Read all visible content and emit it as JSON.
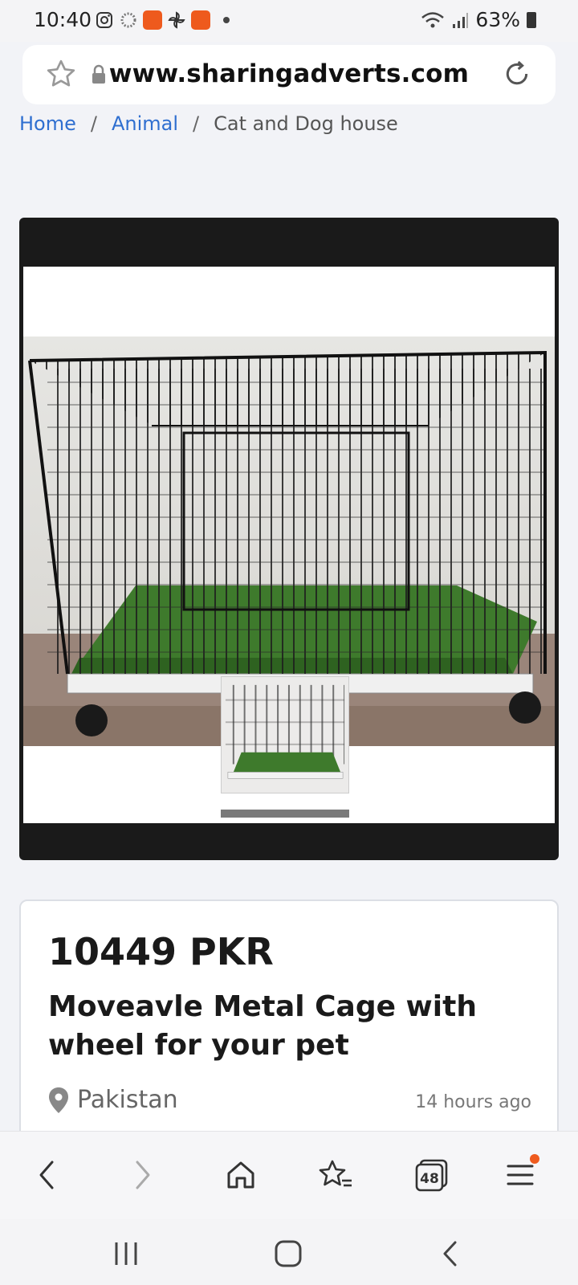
{
  "status_bar": {
    "time": "10:40",
    "battery": "63%"
  },
  "browser": {
    "url": "www.sharingadverts.com"
  },
  "breadcrumb": {
    "items": [
      "Home",
      "Animal",
      "Cat and Dog house"
    ],
    "separator": "/"
  },
  "gallery": {
    "main_image": "metal-pet-cage-photo",
    "thumbnail_image": "metal-pet-cage-thumbnail"
  },
  "listing": {
    "price": "10449 PKR",
    "title": "Moveavle Metal Cage with wheel for your pet",
    "location": "Pakistan",
    "posted": "14 hours ago"
  },
  "bottom_bar": {
    "tab_count": "48"
  },
  "colors": {
    "link": "#2f6fd0",
    "accent": "#ef5b1e",
    "gallery_bg": "#1a1a1a"
  }
}
